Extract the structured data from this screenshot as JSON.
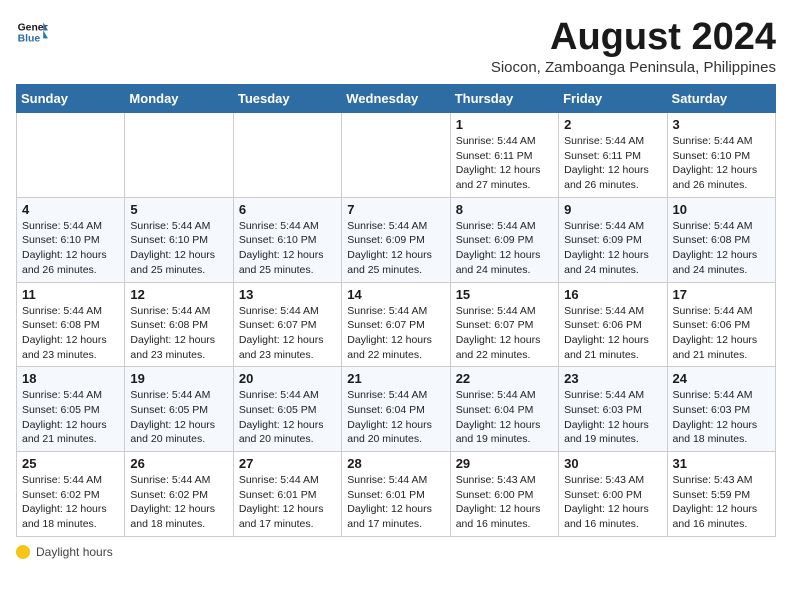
{
  "header": {
    "logo_line1": "General",
    "logo_line2": "Blue",
    "month_title": "August 2024",
    "subtitle": "Siocon, Zamboanga Peninsula, Philippines"
  },
  "days_of_week": [
    "Sunday",
    "Monday",
    "Tuesday",
    "Wednesday",
    "Thursday",
    "Friday",
    "Saturday"
  ],
  "weeks": [
    [
      {
        "day": "",
        "detail": ""
      },
      {
        "day": "",
        "detail": ""
      },
      {
        "day": "",
        "detail": ""
      },
      {
        "day": "",
        "detail": ""
      },
      {
        "day": "1",
        "detail": "Sunrise: 5:44 AM\nSunset: 6:11 PM\nDaylight: 12 hours and 27 minutes."
      },
      {
        "day": "2",
        "detail": "Sunrise: 5:44 AM\nSunset: 6:11 PM\nDaylight: 12 hours and 26 minutes."
      },
      {
        "day": "3",
        "detail": "Sunrise: 5:44 AM\nSunset: 6:10 PM\nDaylight: 12 hours and 26 minutes."
      }
    ],
    [
      {
        "day": "4",
        "detail": "Sunrise: 5:44 AM\nSunset: 6:10 PM\nDaylight: 12 hours and 26 minutes."
      },
      {
        "day": "5",
        "detail": "Sunrise: 5:44 AM\nSunset: 6:10 PM\nDaylight: 12 hours and 25 minutes."
      },
      {
        "day": "6",
        "detail": "Sunrise: 5:44 AM\nSunset: 6:10 PM\nDaylight: 12 hours and 25 minutes."
      },
      {
        "day": "7",
        "detail": "Sunrise: 5:44 AM\nSunset: 6:09 PM\nDaylight: 12 hours and 25 minutes."
      },
      {
        "day": "8",
        "detail": "Sunrise: 5:44 AM\nSunset: 6:09 PM\nDaylight: 12 hours and 24 minutes."
      },
      {
        "day": "9",
        "detail": "Sunrise: 5:44 AM\nSunset: 6:09 PM\nDaylight: 12 hours and 24 minutes."
      },
      {
        "day": "10",
        "detail": "Sunrise: 5:44 AM\nSunset: 6:08 PM\nDaylight: 12 hours and 24 minutes."
      }
    ],
    [
      {
        "day": "11",
        "detail": "Sunrise: 5:44 AM\nSunset: 6:08 PM\nDaylight: 12 hours and 23 minutes."
      },
      {
        "day": "12",
        "detail": "Sunrise: 5:44 AM\nSunset: 6:08 PM\nDaylight: 12 hours and 23 minutes."
      },
      {
        "day": "13",
        "detail": "Sunrise: 5:44 AM\nSunset: 6:07 PM\nDaylight: 12 hours and 23 minutes."
      },
      {
        "day": "14",
        "detail": "Sunrise: 5:44 AM\nSunset: 6:07 PM\nDaylight: 12 hours and 22 minutes."
      },
      {
        "day": "15",
        "detail": "Sunrise: 5:44 AM\nSunset: 6:07 PM\nDaylight: 12 hours and 22 minutes."
      },
      {
        "day": "16",
        "detail": "Sunrise: 5:44 AM\nSunset: 6:06 PM\nDaylight: 12 hours and 21 minutes."
      },
      {
        "day": "17",
        "detail": "Sunrise: 5:44 AM\nSunset: 6:06 PM\nDaylight: 12 hours and 21 minutes."
      }
    ],
    [
      {
        "day": "18",
        "detail": "Sunrise: 5:44 AM\nSunset: 6:05 PM\nDaylight: 12 hours and 21 minutes."
      },
      {
        "day": "19",
        "detail": "Sunrise: 5:44 AM\nSunset: 6:05 PM\nDaylight: 12 hours and 20 minutes."
      },
      {
        "day": "20",
        "detail": "Sunrise: 5:44 AM\nSunset: 6:05 PM\nDaylight: 12 hours and 20 minutes."
      },
      {
        "day": "21",
        "detail": "Sunrise: 5:44 AM\nSunset: 6:04 PM\nDaylight: 12 hours and 20 minutes."
      },
      {
        "day": "22",
        "detail": "Sunrise: 5:44 AM\nSunset: 6:04 PM\nDaylight: 12 hours and 19 minutes."
      },
      {
        "day": "23",
        "detail": "Sunrise: 5:44 AM\nSunset: 6:03 PM\nDaylight: 12 hours and 19 minutes."
      },
      {
        "day": "24",
        "detail": "Sunrise: 5:44 AM\nSunset: 6:03 PM\nDaylight: 12 hours and 18 minutes."
      }
    ],
    [
      {
        "day": "25",
        "detail": "Sunrise: 5:44 AM\nSunset: 6:02 PM\nDaylight: 12 hours and 18 minutes."
      },
      {
        "day": "26",
        "detail": "Sunrise: 5:44 AM\nSunset: 6:02 PM\nDaylight: 12 hours and 18 minutes."
      },
      {
        "day": "27",
        "detail": "Sunrise: 5:44 AM\nSunset: 6:01 PM\nDaylight: 12 hours and 17 minutes."
      },
      {
        "day": "28",
        "detail": "Sunrise: 5:44 AM\nSunset: 6:01 PM\nDaylight: 12 hours and 17 minutes."
      },
      {
        "day": "29",
        "detail": "Sunrise: 5:43 AM\nSunset: 6:00 PM\nDaylight: 12 hours and 16 minutes."
      },
      {
        "day": "30",
        "detail": "Sunrise: 5:43 AM\nSunset: 6:00 PM\nDaylight: 12 hours and 16 minutes."
      },
      {
        "day": "31",
        "detail": "Sunrise: 5:43 AM\nSunset: 5:59 PM\nDaylight: 12 hours and 16 minutes."
      }
    ]
  ],
  "footer": {
    "note": "Daylight hours"
  }
}
